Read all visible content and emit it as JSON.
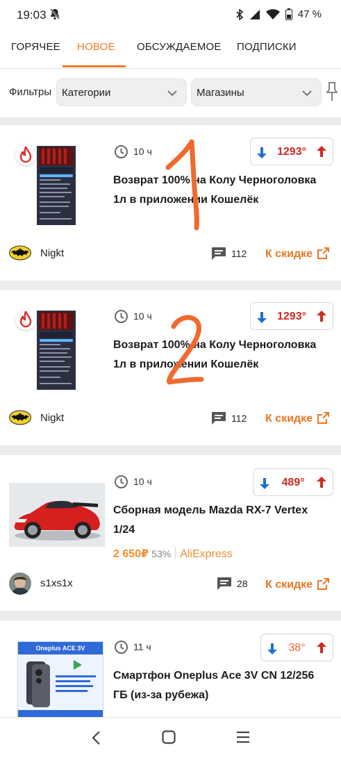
{
  "status_bar": {
    "time": "19:03",
    "battery": "47 %"
  },
  "tabs": [
    {
      "label": "ГОРЯЧЕЕ",
      "active": false
    },
    {
      "label": "НОВОЕ",
      "active": true
    },
    {
      "label": "ОБСУЖДАЕМОЕ",
      "active": false
    },
    {
      "label": "ПОДПИСКИ",
      "active": false
    }
  ],
  "filters": {
    "label": "Фильтры",
    "categories_select": "Категории",
    "shops_select": "Магазины"
  },
  "deals": [
    {
      "time": "10 ч",
      "title_line1": "Возврат 100% на Колу Черноголовка",
      "title_line2": "1л в приложении Кошелёк",
      "temperature": "1293°",
      "temp_color": "#d02a1e",
      "user": "Nigkt",
      "comments": "112",
      "link_label": "К скидке",
      "hot": true,
      "annotation": "1"
    },
    {
      "time": "10 ч",
      "title_line1": "Возврат 100% на Колу Черноголовка",
      "title_line2": "1л в приложении Кошелёк",
      "temperature": "1293°",
      "temp_color": "#d02a1e",
      "user": "Nigkt",
      "comments": "112",
      "link_label": "К скидке",
      "hot": true,
      "annotation": "2"
    },
    {
      "time": "10 ч",
      "title_line1": "Сборная модель Mazda RX-7 Vertex",
      "title_line2": "1/24",
      "price": "2 650₽",
      "discount": "53%",
      "store": "AliExpress",
      "temperature": "489°",
      "temp_color": "#d02a1e",
      "user": "s1xs1x",
      "comments": "28",
      "link_label": "К скидке",
      "hot": false
    },
    {
      "time": "11 ч",
      "title_line1": "Смартфон Oneplus Ace 3V CN 12/256",
      "title_line2": "ГБ (из-за рубежа)",
      "temperature": "38°",
      "temp_color": "#e8653a",
      "thumb_caption": "Oneplus ACE 3V",
      "hot": false
    }
  ],
  "colors": {
    "accent": "#ef7a22",
    "vote_down": "#1f6fd1",
    "vote_up": "#d02a1e",
    "annotation": "#f0692e"
  },
  "nav_bar": {
    "back": "back-icon",
    "home": "home-icon",
    "recents": "menu-icon"
  }
}
